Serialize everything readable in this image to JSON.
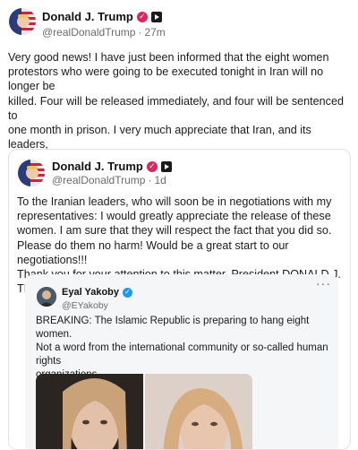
{
  "colors": {
    "verified_red": "#e0245e",
    "verified_blue": "#1d9bf0",
    "text": "#1a1a1a",
    "muted": "#6b6b6b",
    "card_border": "#dfe2e6",
    "embed_bg": "#f5f6f8"
  },
  "post": {
    "author": {
      "name": "Donald J. Trump",
      "handle": "@realDonaldTrump",
      "separator": "·",
      "time": "27m",
      "badges": [
        "verified-check-icon",
        "app-icon"
      ]
    },
    "text": "Very good news! I have just been informed that the eight women\nprotestors who were going to be executed tonight in Iran will no longer be\nkilled. Four will be released immediately, and four will be sentenced to\none month in prison. I very much appreciate that Iran, and its leaders,\nrespected my request, as President of the United States, and terminated\nthe planned execution. Thank you for your attention to this matter!\nPresident DONALD J. TRUMP"
  },
  "quoted": {
    "author": {
      "name": "Donald J. Trump",
      "handle": "@realDonaldTrump",
      "separator": "·",
      "time": "1d",
      "badges": [
        "verified-check-icon",
        "app-icon"
      ]
    },
    "text": "To the Iranian leaders, who will soon be in negotiations with my\nrepresentatives: I would greatly appreciate the release of these\nwomen. I am sure that they will respect the fact that you did so.\nPlease do them no harm! Would be a great start to our negotiations!!!\nThank you for your attention to this matter. President DONALD J.\nTRUMP",
    "embed": {
      "author": {
        "name": "Eyal Yakoby",
        "handle": "@EYakoby",
        "badges": [
          "verified-blue-check-icon"
        ]
      },
      "more_icon": "more-horizontal-icon",
      "text_1": "BREAKING: The Islamic Republic is preparing to hang eight women.",
      "text_2": "Not a word from the international community or so-called human rights\norganizations."
    }
  }
}
